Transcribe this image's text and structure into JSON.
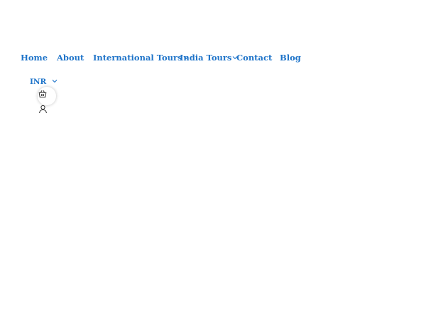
{
  "nav": {
    "items": [
      {
        "label": "Home",
        "has_dropdown": false
      },
      {
        "label": "About",
        "has_dropdown": false
      },
      {
        "label": "International Tours",
        "has_dropdown": true
      },
      {
        "label": "India Tours",
        "has_dropdown": true
      },
      {
        "label": "Contact",
        "has_dropdown": false
      },
      {
        "label": "Blog",
        "has_dropdown": false
      }
    ]
  },
  "currency": {
    "selected": "INR",
    "icon": "chevron-down-icon"
  },
  "header_actions": {
    "cart_icon": "basket-icon",
    "account_icon": "user-icon"
  },
  "colors": {
    "link": "#1f74c9",
    "background": "#ffffff",
    "icon": "#333333"
  }
}
